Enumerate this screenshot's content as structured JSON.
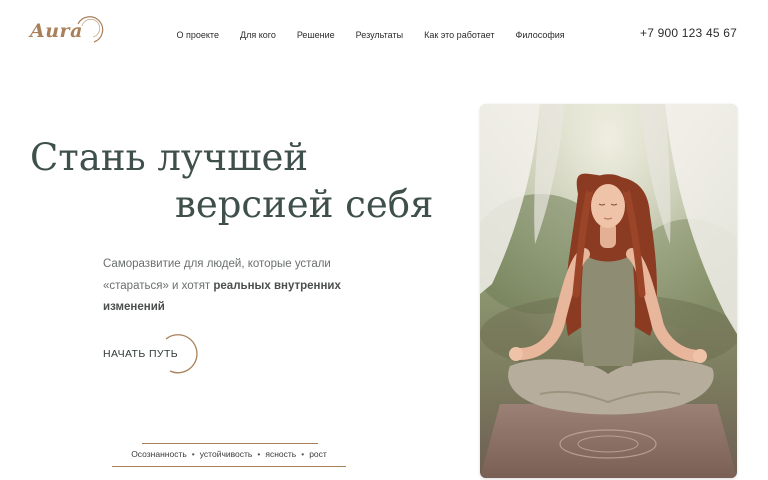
{
  "brand": {
    "logo_text": "Aura"
  },
  "nav": {
    "items": [
      {
        "label": "О проекте"
      },
      {
        "label": "Для кого"
      },
      {
        "label": "Решение"
      },
      {
        "label": "Результаты"
      },
      {
        "label": "Как это работает"
      },
      {
        "label": "Философия"
      }
    ]
  },
  "header": {
    "phone": "+7 900 123 45 67"
  },
  "hero": {
    "title_line1": "Стань лучшей",
    "title_line2": "версией себя",
    "subtitle_plain": "Саморазвитие для людей, которые устали «стараться» и хотят ",
    "subtitle_bold": "реальных внутренних изменений",
    "cta_label": "НАЧАТЬ ПУТЬ"
  },
  "tags": [
    "Осознанность",
    "устойчивость",
    "ясность",
    "рост"
  ],
  "colors": {
    "accent": "#a8805a",
    "title": "#3f4f4b",
    "text_muted": "#6a6f6d"
  }
}
